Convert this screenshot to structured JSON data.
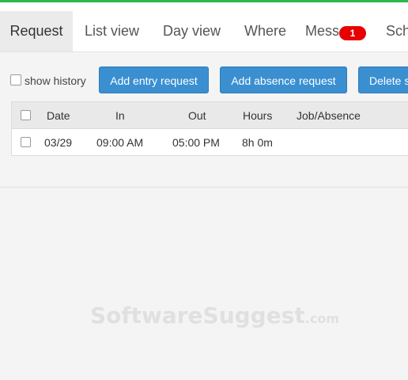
{
  "tabs": [
    {
      "label": "Request",
      "active": true
    },
    {
      "label": "List view",
      "active": false
    },
    {
      "label": "Day view",
      "active": false
    },
    {
      "label": "Where",
      "active": false
    },
    {
      "label": "Mess",
      "active": false,
      "badge": "1"
    },
    {
      "label": "Sch",
      "active": false
    }
  ],
  "toolbar": {
    "show_history_label": "show history",
    "add_entry_label": "Add entry request",
    "add_absence_label": "Add absence request",
    "delete_label": "Delete s"
  },
  "table": {
    "columns": [
      "Date",
      "In",
      "Out",
      "Hours",
      "Job/Absence"
    ],
    "rows": [
      {
        "date": "03/29",
        "in": "09:00 AM",
        "out": "05:00 PM",
        "hours": "8h 0m",
        "job": ""
      }
    ]
  },
  "watermark": {
    "main": "SoftwareSuggest",
    "tld": ".com"
  },
  "colors": {
    "accent": "#3a8fd1",
    "top_strip": "#2cb84b",
    "badge": "#e60000"
  }
}
